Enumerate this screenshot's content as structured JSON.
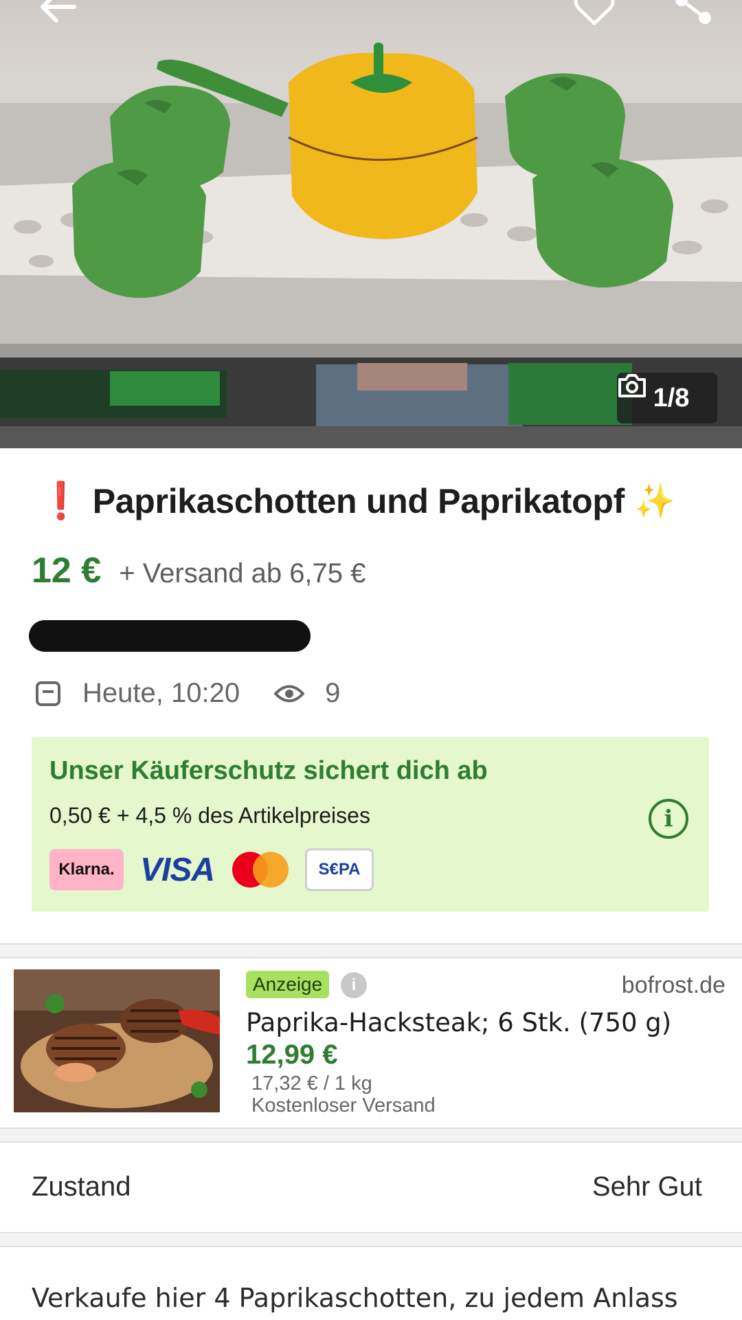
{
  "header": {
    "photo_counter": "1/8",
    "icons": [
      "back-arrow-icon",
      "heart-icon",
      "share-icon",
      "camera-icon"
    ]
  },
  "listing": {
    "title_prefix": "❗",
    "title": "Paprikaschotten und Paprikatopf",
    "title_suffix": "✨",
    "price": "12 €",
    "shipping": "+ Versand ab 6,75 €",
    "date": "Heute, 10:20",
    "views": "9"
  },
  "buyer_protection": {
    "title": "Unser Käuferschutz sichert dich ab",
    "fee": "0,50 € + 4,5 % des Artikelpreises",
    "payment_methods": {
      "klarna": "Klarna.",
      "visa": "VISA",
      "sepa": "S€PA"
    },
    "colors": {
      "background": "#e5f7cc",
      "accent": "#2e7d32"
    }
  },
  "ad": {
    "badge": "Anzeige",
    "domain": "bofrost.de",
    "title": "Paprika-Hacksteak; 6 Stk. (750 g)",
    "price": "12,99 €",
    "unit_price": "17,32 € / 1 kg",
    "shipping": "Kostenloser Versand"
  },
  "details": {
    "condition_label": "Zustand",
    "condition_value": "Sehr Gut"
  },
  "description": {
    "text": "Verkaufe hier 4 Paprikaschotten, zu jedem Anlass"
  }
}
